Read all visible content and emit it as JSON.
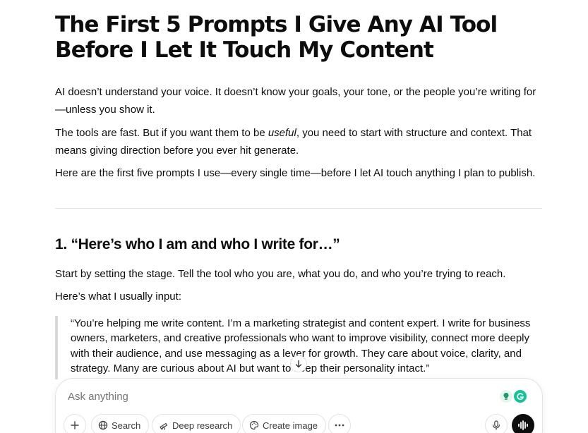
{
  "article": {
    "title": "The First 5 Prompts I Give Any AI Tool Before I Let It Touch My Content",
    "intro_1": "AI doesn’t understand your voice. It doesn’t know your goals, your tone, or the people you’re writing for—unless you show it.",
    "intro_2_before": "The tools are fast. But if you want them to be ",
    "intro_2_em": "useful",
    "intro_2_after": ", you need to start with structure and context. That means giving direction before you ever hit generate.",
    "intro_3": "Here are the first five prompts I use—every single time—before I let AI touch anything I plan to publish.",
    "section_1": {
      "heading": "1. “Here’s who I am and who I write for…”",
      "body": "Start by setting the stage. Tell the tool who you are, what you do, and who you’re trying to reach.",
      "lead_in": "Here’s what I usually input:",
      "quote": "“You’re helping me write content. I’m a marketing strategist and content expert. I write for business owners, marketers, and creative professionals who want to improve visibility, connect more deeply with their audience, and use messaging as a lever for growth. They care about voice, clarity, and strategy. Many are curious about AI but want to keep their personality intact.”"
    }
  },
  "composer": {
    "placeholder": "Ask anything",
    "tools": {
      "search": "Search",
      "deep_research": "Deep research",
      "create_image": "Create image"
    }
  },
  "icons": {
    "scroll": "arrow-down-icon",
    "plus": "plus-icon",
    "globe": "globe-icon",
    "research": "telescope-icon",
    "image": "palette-icon",
    "more": "ellipsis-icon",
    "mic": "microphone-icon",
    "voice": "voice-waveform-icon",
    "extension_1": "lightbulb-icon",
    "extension_2": "grammarly-icon"
  },
  "colors": {
    "text": "#0d0d0d",
    "placeholder": "#8f8f8f",
    "grammarly": "#15c39a",
    "voice_button": "#0d0d0d"
  }
}
